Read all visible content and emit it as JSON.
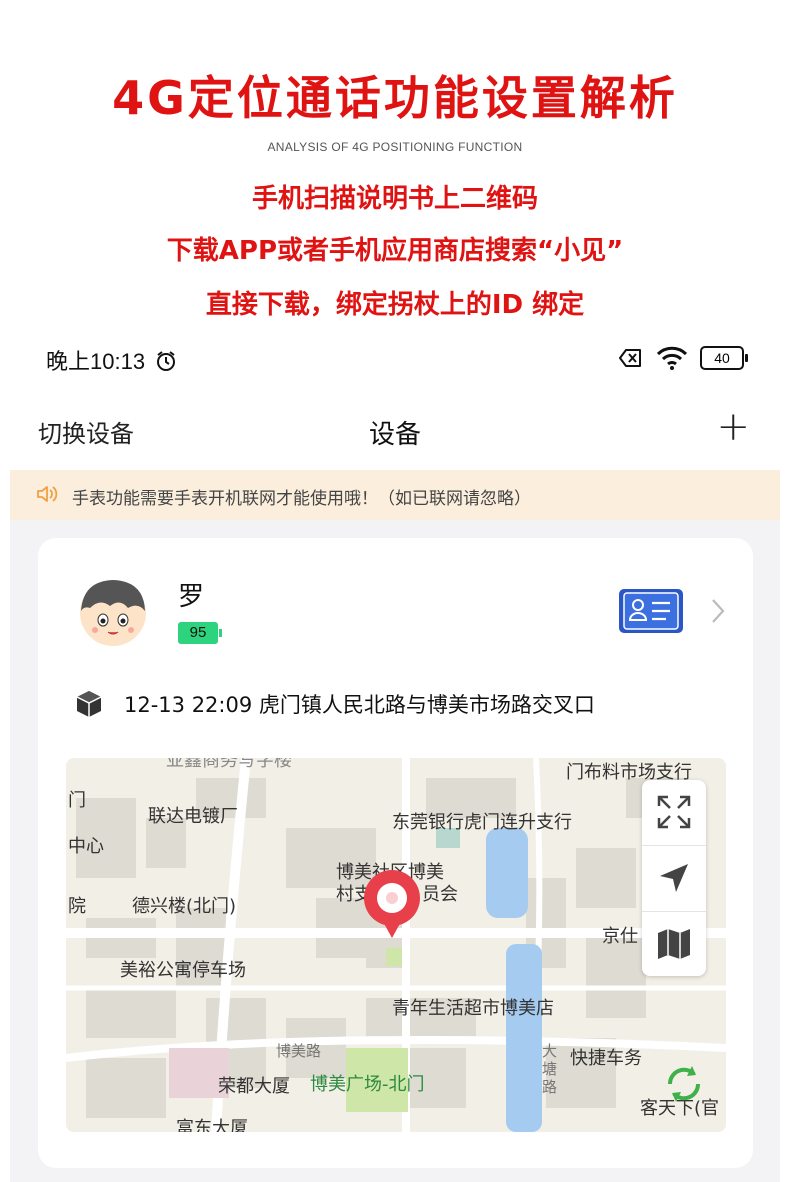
{
  "promo": {
    "title": "4G定位通话功能设置解析",
    "subtitle": "ANALYSIS OF 4G POSITIONING FUNCTION",
    "lines": [
      "手机扫描说明书上二维码",
      "下载APP或者手机应用商店搜索“小见”",
      "直接下载，绑定拐杖上的ID 绑定"
    ]
  },
  "status_bar": {
    "time": "晚上10:13",
    "battery": "40"
  },
  "nav": {
    "left": "切换设备",
    "title": "设备",
    "add": "+"
  },
  "notice": {
    "text": "手表功能需要手表开机联网才能使用哦！（如已联网请忽略）"
  },
  "device": {
    "name": "罗",
    "battery": "95",
    "location_text": "12-13 22:09 虎门镇人民北路与博美市场路交叉口"
  },
  "map": {
    "labels": {
      "l1": "亚鑫商务写字楼",
      "l2": "门布料市场支行",
      "l3": "门",
      "l4": "联达电镀厂",
      "l5": "东莞银行虎门连升支行",
      "l6": "中心",
      "l7": "博美社区博美",
      "l8": "村支",
      "l9": "员会",
      "l10": "院",
      "l11": "德兴楼(北门)",
      "l12": "京仕",
      "l13": "美裕公寓停车场",
      "l14": "青年生活超市博美店",
      "l15": "博美路",
      "l16": "大塘路",
      "l17": "快捷车务",
      "l18": "荣都大厦",
      "l19": "博美广场-北门",
      "l20": "客天下(官",
      "l21": "富东大厦"
    }
  },
  "colors": {
    "accent_red": "#e01313",
    "notice_bg": "#fbeedd",
    "battery_green": "#2ed37d",
    "id_blue": "#2a56c6"
  },
  "icons": [
    "alarm-clock-icon",
    "no-sim-icon",
    "wifi-icon",
    "battery-icon",
    "speaker-icon",
    "avatar",
    "id-card-icon",
    "chevron-right-icon",
    "cube-icon",
    "location-pin-icon",
    "expand-icon",
    "navigate-icon",
    "map-icon",
    "refresh-icon"
  ]
}
